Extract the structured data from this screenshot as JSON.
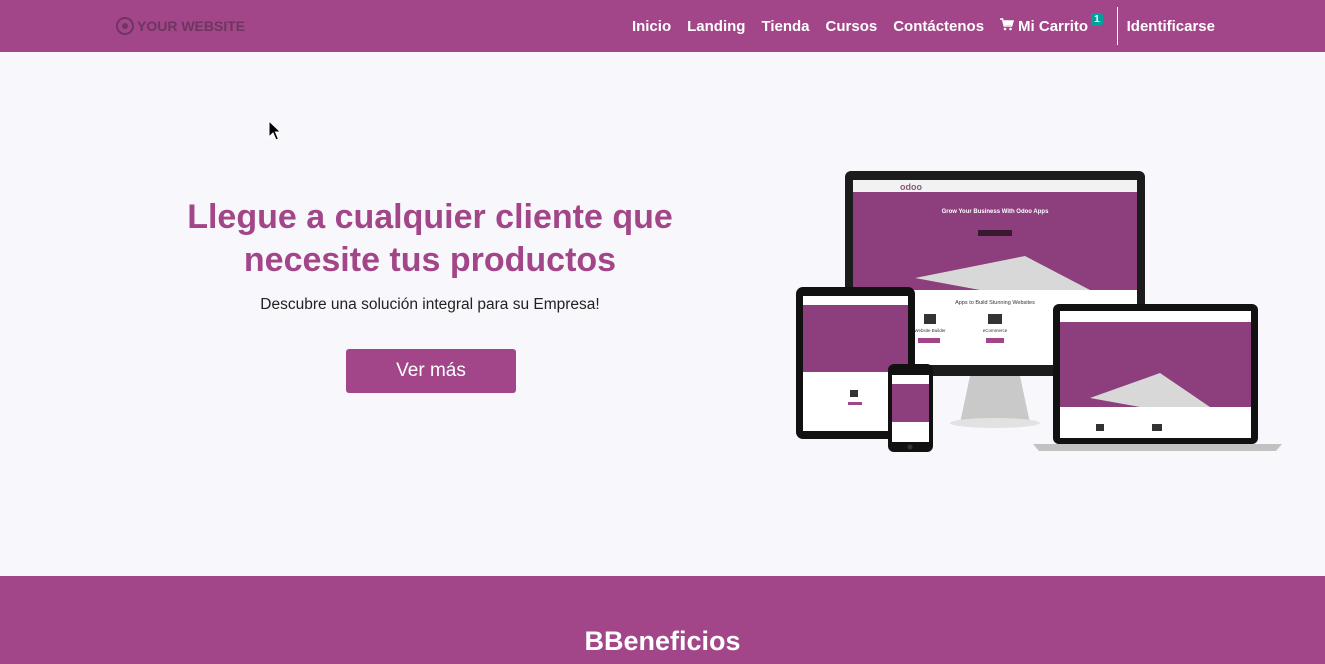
{
  "nav": {
    "logo_text": "YOUR WEBSITE",
    "items": [
      {
        "label": "Inicio"
      },
      {
        "label": "Landing"
      },
      {
        "label": "Tienda"
      },
      {
        "label": "Cursos"
      },
      {
        "label": "Contáctenos"
      }
    ],
    "cart": {
      "label": "Mi Carrito",
      "count": "1",
      "icon": "shopping-cart-icon"
    },
    "signin_label": "Identificarse"
  },
  "hero": {
    "title": "Llegue a cualquier cliente que necesite tus productos",
    "subtitle": "Descubre una solución integral para su Empresa!",
    "button_label": "Ver más"
  },
  "mockup": {
    "brand": "odoo",
    "headline": "Grow Your Business With Odoo Apps",
    "section_title": "Apps to Build Stunning Websites",
    "app_1": "Website Builder",
    "app_2": "eCommerce"
  },
  "benefits": {
    "title": "BBeneficios"
  },
  "colors": {
    "primary": "#a24689",
    "badge": "#00a09d",
    "background": "#f8f7fc"
  }
}
